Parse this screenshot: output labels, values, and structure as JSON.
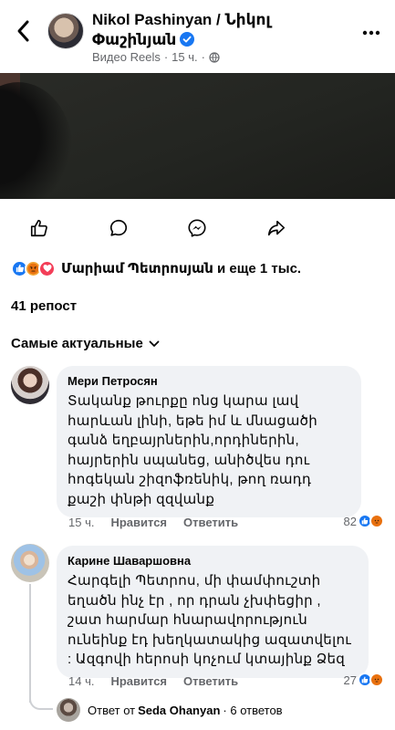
{
  "header": {
    "title": "Nikol Pashinyan / Նիկոլ Փաշինյան",
    "meta_type": "Видео Reels",
    "meta_sep": "·",
    "meta_time": "15 ч.",
    "meta_globe_sep": "·"
  },
  "reactions": {
    "icons": [
      "like-icon",
      "angry-icon",
      "love-icon"
    ],
    "summary": "Մարիամ Պետրոսյան и еще 1 тыс."
  },
  "reposts": "41 репост",
  "sort_label": "Самые актуальные",
  "comments": [
    {
      "author": "Мери Петросян",
      "text": "Տականք թուրքը ոնց կարա լավ հարևան լինի, եթե իմ  և մնացածի գանձ եղբայրներին,որդիներին, հայրերին սպանեց, անիծվես դու հոգեկան շիզոֆռենիկ, թող ռադդ քաշի  փնթի զզվանք",
      "time": "15 ч.",
      "like_label": "Нравится",
      "reply_label": "Ответить",
      "reaction_count": "82"
    },
    {
      "author": "Карине Шаваршовна",
      "text": "Հարգելի Պետրոս, մի փամփուշտի եղածն ինչ էր , որ դրան չխփեցիր , շատ հարմար հնարավորություն ունեինք էդ խեղկատակից ազատվելու : Ազգովի հերոսի կոչում կտայինք Ձեզ",
      "time": "14 ч.",
      "like_label": "Нравится",
      "reply_label": "Ответить",
      "reaction_count": "27"
    }
  ],
  "replies": {
    "prefix": "Ответ от",
    "author": "Seda Ohanyan",
    "suffix": "· 6 ответов"
  },
  "colors": {
    "accent": "#1877f2",
    "angry": "#f3a536",
    "love": "#f33e58",
    "secondary_text": "#65676b",
    "bubble": "#f0f2f5"
  }
}
